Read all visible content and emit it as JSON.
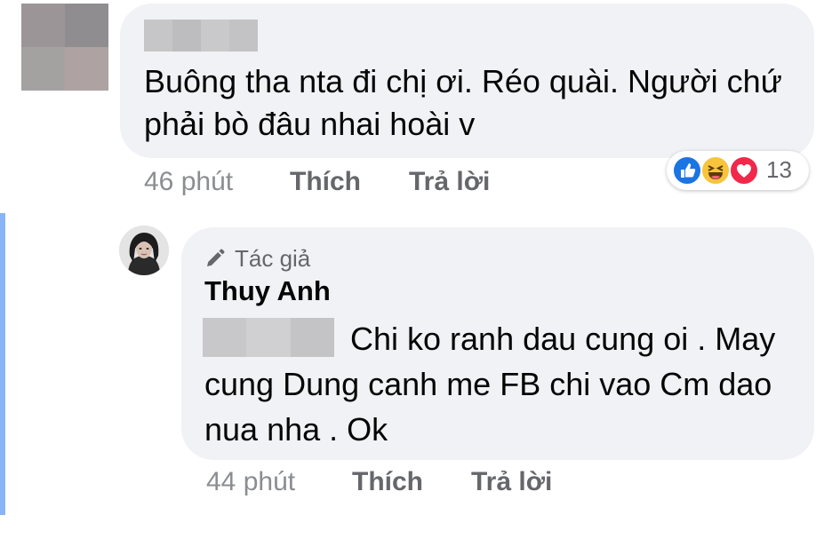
{
  "comment": {
    "text": "Buông tha nta đi chị ơi. Réo quài. Người chứ phải bò đâu nhai hoài v",
    "time": "46 phút",
    "like_label": "Thích",
    "reply_label": "Trả lời",
    "reactions": {
      "icons": [
        "like-icon",
        "haha-icon",
        "love-icon"
      ],
      "count": "13"
    }
  },
  "reply": {
    "author_badge": "Tác giả",
    "author_name": "Thuy Anh",
    "text": "Chi ko ranh dau cung oi . May cung Dung canh me FB chi vao Cm dao nua nha . Ok",
    "time": "44 phút",
    "like_label": "Thích",
    "reply_label": "Trả lời"
  },
  "colors": {
    "bubble": "#f0f2f5",
    "meta_text": "#65676b",
    "like_blue": "#1b74e4",
    "haha_yellow": "#f7c43c",
    "love_red": "#f0284a",
    "thread_rule": "#8ab4f8"
  }
}
